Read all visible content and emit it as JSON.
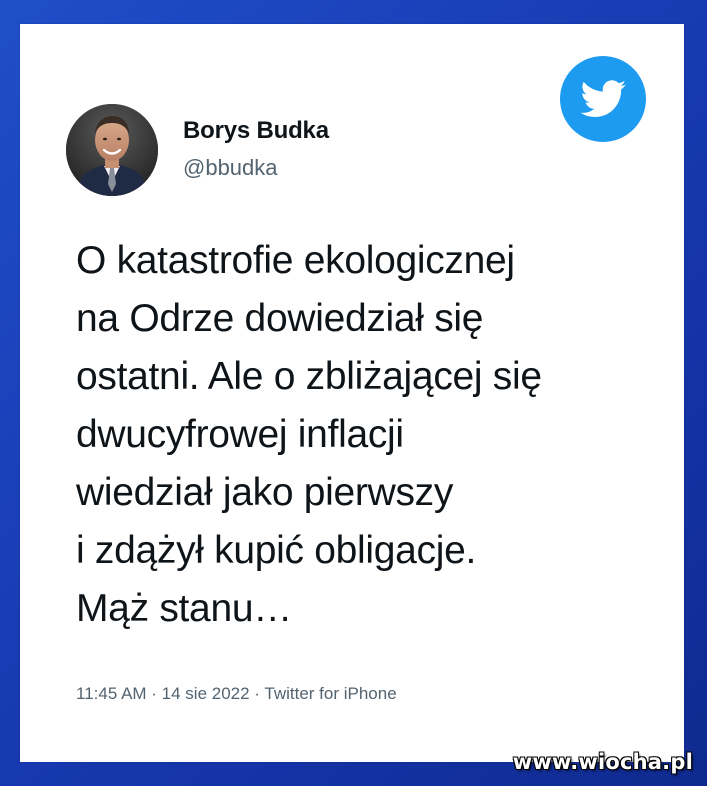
{
  "colors": {
    "background": "#1a3fb8",
    "card": "#ffffff",
    "text_primary": "#0f1419",
    "text_secondary": "#536471",
    "twitter_blue": "#1d9bf0"
  },
  "tweet": {
    "author_name": "Borys Budka",
    "author_handle": "@bbudka",
    "text_lines": [
      "O katastrofie ekologicznej",
      "na Odrze dowiedział się",
      "ostatni. Ale o zbliżającej się",
      "dwucyfrowej inflacji",
      "wiedział jako pierwszy",
      "i zdążył kupić obligacje.",
      "Mąż stanu…"
    ],
    "meta": "11:45 AM · 14 sie 2022 · Twitter for iPhone",
    "logo_icon": "twitter-bird-icon",
    "avatar_icon": "profile-photo"
  },
  "watermark": {
    "text": "www.wiocha.pl"
  }
}
